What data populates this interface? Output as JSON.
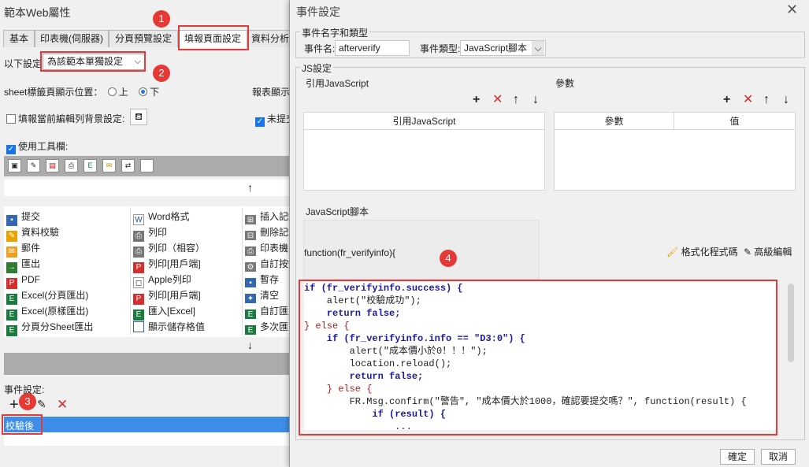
{
  "left": {
    "title": "範本Web屬性",
    "tabs": [
      "基本",
      "印表機(伺服器)",
      "分頁預覽設定",
      "填報頁面設定",
      "資料分析"
    ],
    "scope_label": "以下設定",
    "scope_value": "為該範本單獨設定",
    "sheet_tab_label": "sheet標籤頁顯示位置：",
    "sheet_top": "上",
    "sheet_bottom": "下",
    "report_show": "報表顯示",
    "bg_setting": "填報當前編輯列背景設定:",
    "unsubmitted": "未提交",
    "use_toolbar": "使用工具欄:",
    "up_arrow": "↑",
    "down_arrow": "↓",
    "buttons_col1": [
      "提交",
      "資料校驗",
      "郵件",
      "匯出",
      "PDF",
      "Excel(分頁匯出)",
      "Excel(原樣匯出)",
      "分頁分Sheet匯出"
    ],
    "buttons_col2": [
      "Word格式",
      "列印",
      "列印（相容）",
      "列印[用戶端]",
      "Apple列印",
      "列印[用戶端]",
      "匯入[Excel]",
      "顯示儲存格值"
    ],
    "buttons_col3": [
      "插入記錄",
      "刪除記錄",
      "印表機",
      "自訂按鈕",
      "暫存",
      "清空",
      "自訂匯入",
      "多次匯入"
    ],
    "event_setting": "事件設定:",
    "event_item": "校驗後",
    "badges": [
      "1",
      "2",
      "3",
      "4"
    ]
  },
  "dialog": {
    "title": "事件設定",
    "name_type_group": "事件名字和類型",
    "event_name_label": "事件名:",
    "event_name_value": "afterverify",
    "event_type_label": "事件類型:",
    "event_type_value": "JavaScript腳本",
    "js_group": "JS設定",
    "ref_js_label": "引用JavaScript",
    "params_label": "參數",
    "ref_js_header": "引用JavaScript",
    "param_header": "參數",
    "value_header": "值",
    "script_label": "JavaScript腳本",
    "func_sig": "function(fr_verifyinfo){",
    "format_code": "格式化程式碼",
    "advanced_edit": "高級編輯",
    "ok": "確定",
    "cancel": "取消"
  },
  "code_lines": [
    "if (fr_verifyinfo.success) {",
    "    alert(\"校驗成功\");",
    "    return false;",
    "} else {",
    "    if (fr_verifyinfo.info == \"D3:0\") {",
    "        alert(\"成本價小於0！！！\");",
    "        location.reload();",
    "        return false;",
    "    } else {",
    "        FR.Msg.confirm(\"警告\", \"成本價大於1000，確認要提交嗎？\", function(result) {",
    "            if (result) {",
    "                ...",
    "}"
  ],
  "colors": {
    "accent": "#1a73e8",
    "highlight": "#e03c3c",
    "selection": "#3d8ee8"
  }
}
